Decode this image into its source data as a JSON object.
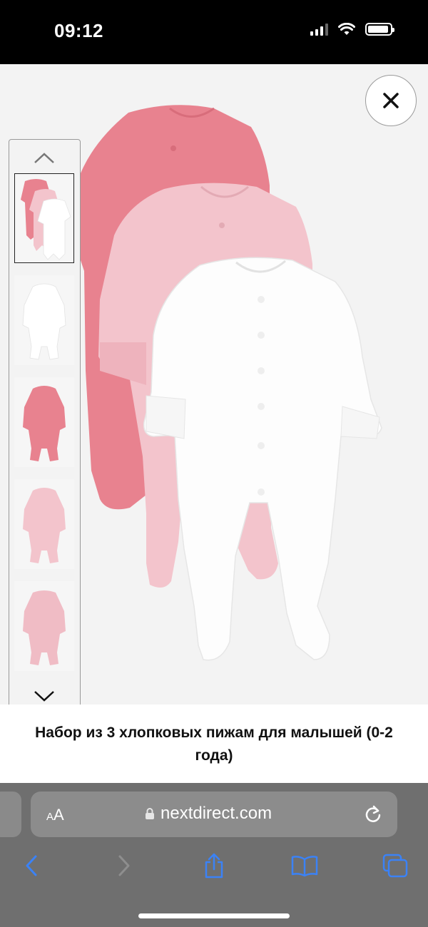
{
  "status_bar": {
    "time": "09:12",
    "icons": [
      "signal-icon",
      "wifi-icon",
      "battery-icon"
    ]
  },
  "product": {
    "title": "Набор из 3 хлопковых пижам для малышей (0-2 года)",
    "thumbnails": [
      {
        "name": "thumbnail-set-of-three",
        "selected": true
      },
      {
        "name": "thumbnail-white",
        "selected": false
      },
      {
        "name": "thumbnail-dark-pink",
        "selected": false
      },
      {
        "name": "thumbnail-light-pink",
        "selected": false
      },
      {
        "name": "thumbnail-pink-back",
        "selected": false
      }
    ],
    "garment_colors": {
      "dark_pink": "#e8828f",
      "light_pink": "#f3c4cc",
      "white": "#fdfdfd"
    }
  },
  "browser": {
    "text_size_label_small": "A",
    "text_size_label_large": "A",
    "url": "nextdirect.com",
    "accent_color": "#3b82f6"
  }
}
